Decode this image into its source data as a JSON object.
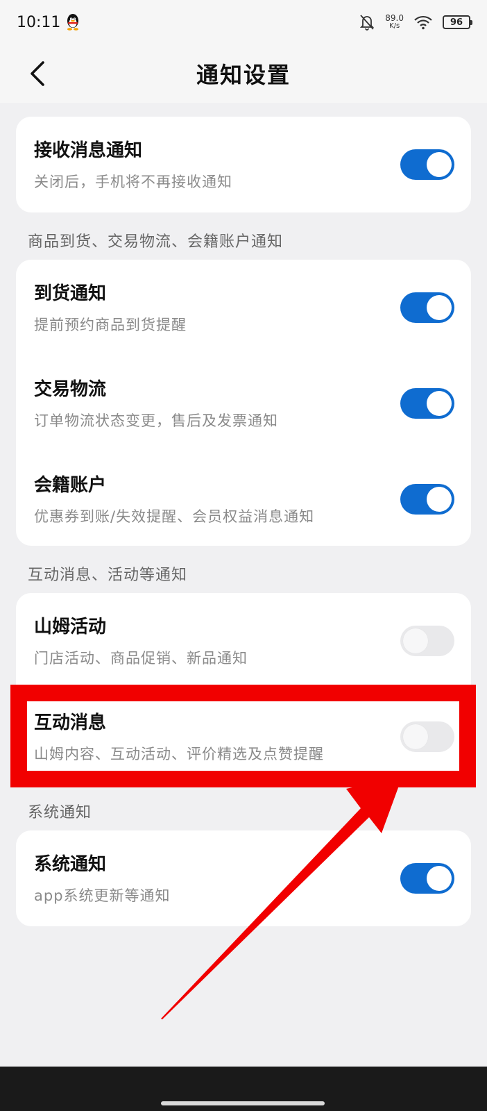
{
  "status_bar": {
    "time": "10:11",
    "net_speed": "89.0",
    "net_unit": "K/s",
    "battery": "96"
  },
  "header": {
    "title": "通知设置"
  },
  "main_card": {
    "title": "接收消息通知",
    "desc": "关闭后，手机将不再接收通知",
    "on": true
  },
  "sections": [
    {
      "label": "商品到货、交易物流、会籍账户通知",
      "items": [
        {
          "title": "到货通知",
          "desc": "提前预约商品到货提醒",
          "on": true
        },
        {
          "title": "交易物流",
          "desc": "订单物流状态变更，售后及发票通知",
          "on": true
        },
        {
          "title": "会籍账户",
          "desc": "优惠券到账/失效提醒、会员权益消息通知",
          "on": true
        }
      ]
    },
    {
      "label": "互动消息、活动等通知",
      "items": [
        {
          "title": "山姆活动",
          "desc": "门店活动、商品促销、新品通知",
          "on": false
        },
        {
          "title": "互动消息",
          "desc": "山姆内容、互动活动、评价精选及点赞提醒",
          "on": false
        }
      ]
    },
    {
      "label": "系统通知",
      "items": [
        {
          "title": "系统通知",
          "desc": "app系统更新等通知",
          "on": true
        }
      ]
    }
  ],
  "colors": {
    "toggle_on": "#0f6cd0",
    "toggle_off": "#e9e9eb",
    "highlight": "#f10000"
  },
  "icons": {
    "back": "chevron-left-icon",
    "qq": "qq-penguin-icon",
    "bell_off": "bell-off-icon",
    "wifi": "wifi-icon",
    "battery": "battery-icon"
  }
}
